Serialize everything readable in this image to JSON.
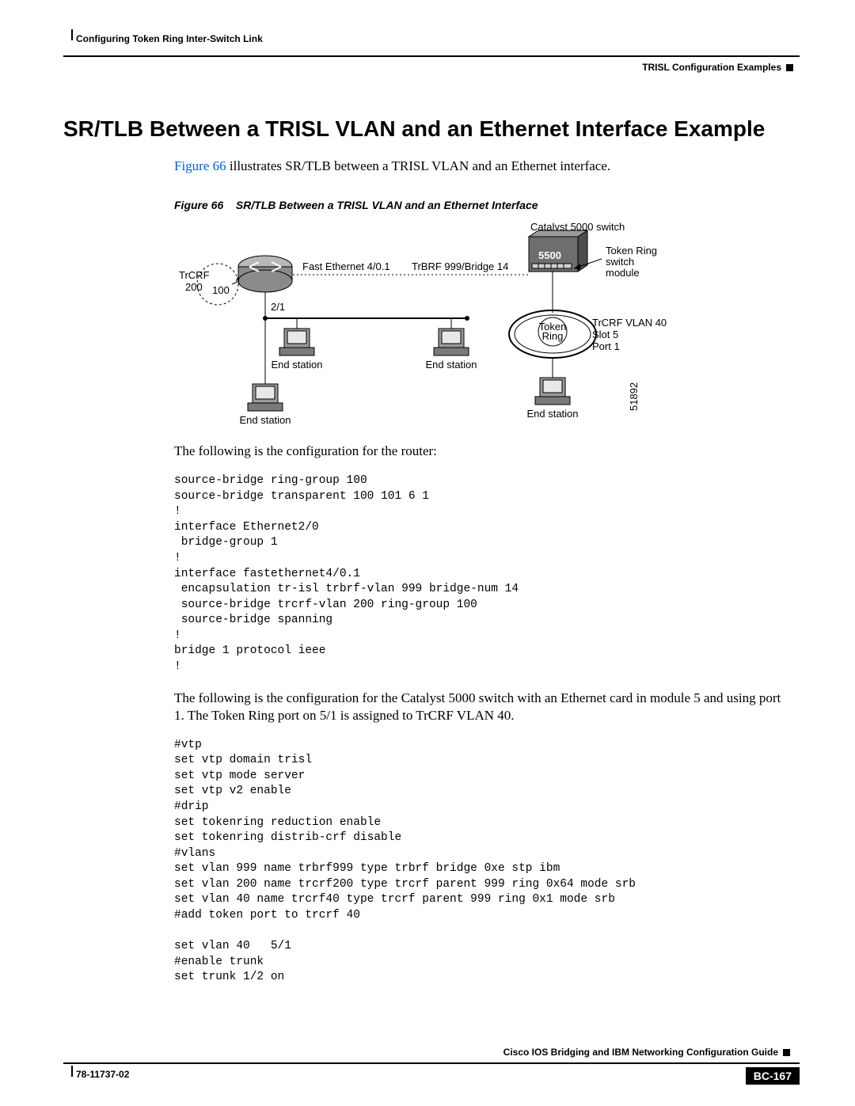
{
  "header": {
    "chapter": "Configuring Token Ring Inter-Switch Link",
    "section": "TRISL Configuration Examples"
  },
  "title": "SR/TLB Between a TRISL VLAN and an Ethernet Interface Example",
  "intro_ref": "Figure 66",
  "intro_text": " illustrates SR/TLB between a TRISL VLAN and an Ethernet interface.",
  "figure": {
    "label": "Figure 66",
    "caption": "SR/TLB Between a TRISL VLAN and an Ethernet Interface"
  },
  "diagram": {
    "catalyst": "Catalyst 5000 switch",
    "switch_num": "5500",
    "tr_module": "Token Ring\nswitch\nmodule",
    "trcrf": "TrCRF\n200",
    "ring100": "100",
    "port21": "2/1",
    "fe": "Fast Ethernet 4/0.1",
    "trbrf": "TrBRF 999/Bridge 14",
    "token_ring": "Token\nRing",
    "vlan40": "TrCRF VLAN 40\nSlot 5\nPort 1",
    "end_station": "End station",
    "imgid": "51892"
  },
  "para1": "The following is the configuration for the router:",
  "code1": "source-bridge ring-group 100\nsource-bridge transparent 100 101 6 1\n!\ninterface Ethernet2/0\n bridge-group 1\n!\ninterface fastethernet4/0.1\n encapsulation tr-isl trbrf-vlan 999 bridge-num 14\n source-bridge trcrf-vlan 200 ring-group 100\n source-bridge spanning\n!\nbridge 1 protocol ieee\n!",
  "para2": "The following is the configuration for the Catalyst 5000 switch with an Ethernet card in module 5 and using port 1. The Token Ring port on 5/1 is assigned to TrCRF VLAN 40.",
  "code2": "#vtp\nset vtp domain trisl\nset vtp mode server\nset vtp v2 enable\n#drip\nset tokenring reduction enable\nset tokenring distrib-crf disable\n#vlans\nset vlan 999 name trbrf999 type trbrf bridge 0xe stp ibm\nset vlan 200 name trcrf200 type trcrf parent 999 ring 0x64 mode srb\nset vlan 40 name trcrf40 type trcrf parent 999 ring 0x1 mode srb\n#add token port to trcrf 40\n\nset vlan 40   5/1\n#enable trunk\nset trunk 1/2 on",
  "footer": {
    "guide": "Cisco IOS Bridging and IBM Networking Configuration Guide",
    "docnum": "78-11737-02",
    "page": "BC-167"
  }
}
